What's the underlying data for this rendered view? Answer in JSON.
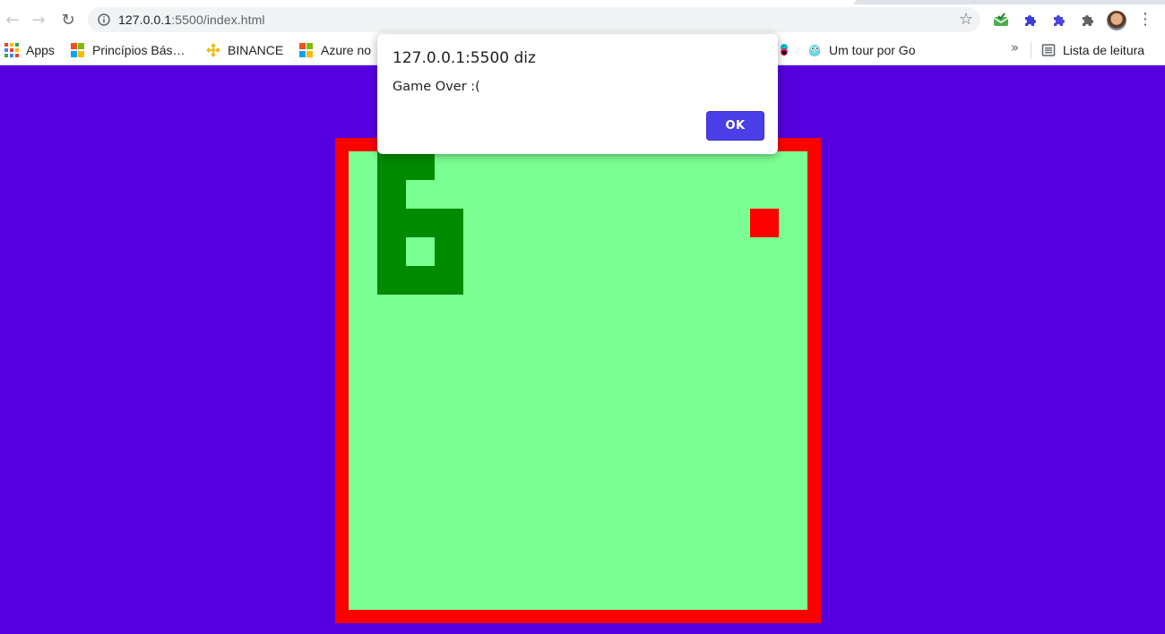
{
  "browser": {
    "address": {
      "host": "127.0.0.1",
      "rest": ":5500/index.html"
    },
    "bookmarks": [
      {
        "label": "Apps",
        "icon": "apps-grid-icon"
      },
      {
        "label": "Princípios Bás…",
        "icon": "microsoft-logo-icon"
      },
      {
        "label": "BINANCE",
        "icon": "binance-icon"
      },
      {
        "label": "Azure no",
        "icon": "microsoft-logo-icon"
      },
      {
        "label": "Um tour por Go",
        "icon": "gopher-icon"
      }
    ],
    "overflow": "»",
    "reading_list": "Lista de leitura"
  },
  "dialog": {
    "title": "127.0.0.1:5500 diz",
    "message": "Game Over :(",
    "ok_label": "OK"
  },
  "game": {
    "colors": {
      "background": "#5600e0",
      "border": "#ff0000",
      "field": "#7cff92",
      "snake": "#008a00",
      "food": "#ff0000"
    },
    "grid_cells": 16,
    "snake": [
      [
        1,
        0
      ],
      [
        2,
        0
      ],
      [
        1,
        1
      ],
      [
        1,
        2
      ],
      [
        1,
        3
      ],
      [
        1,
        4
      ],
      [
        2,
        4
      ],
      [
        3,
        4
      ],
      [
        3,
        3
      ],
      [
        3,
        2
      ],
      [
        2,
        2
      ]
    ],
    "food": [
      14,
      2
    ]
  }
}
